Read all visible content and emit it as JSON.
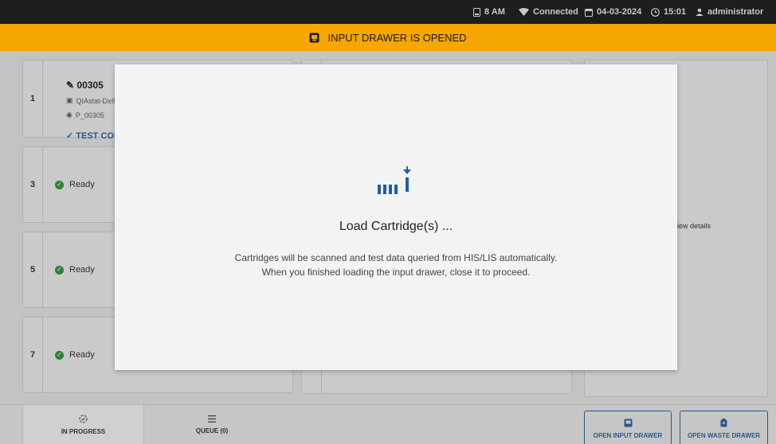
{
  "status_bar": {
    "slot_count": "8 AM",
    "connection": "Connected",
    "date": "04-03-2024",
    "time": "15:01",
    "user": "administrator"
  },
  "alert": {
    "text": "INPUT DRAWER IS OPENED",
    "color": "#f5a600"
  },
  "slots": [
    {
      "number": "1",
      "cartridge_id": "00305",
      "assay": "QIAstat-Dx® Re",
      "sample_id": "P_00305",
      "status": "TEST COMP"
    },
    {
      "number": "3",
      "status": "Ready"
    },
    {
      "number": "5",
      "status": "Ready"
    },
    {
      "number": "7",
      "status": "Ready"
    }
  ],
  "right_panel": {
    "link_text": "iew details"
  },
  "bottom_nav": {
    "in_progress": "IN PROGRESS",
    "queue": "QUEUE (0)",
    "open_input_drawer": "OPEN INPUT DRAWER",
    "open_waste_drawer": "OPEN WASTE DRAWER"
  },
  "modal": {
    "title": "Load Cartridge(s) ...",
    "line1": "Cartridges will be scanned and test data queried from HIS/LIS automatically.",
    "line2": "When you finished loading the input drawer, close it to proceed.",
    "icon": "load-cartridge-icon",
    "accent": "#1f5fa5"
  }
}
